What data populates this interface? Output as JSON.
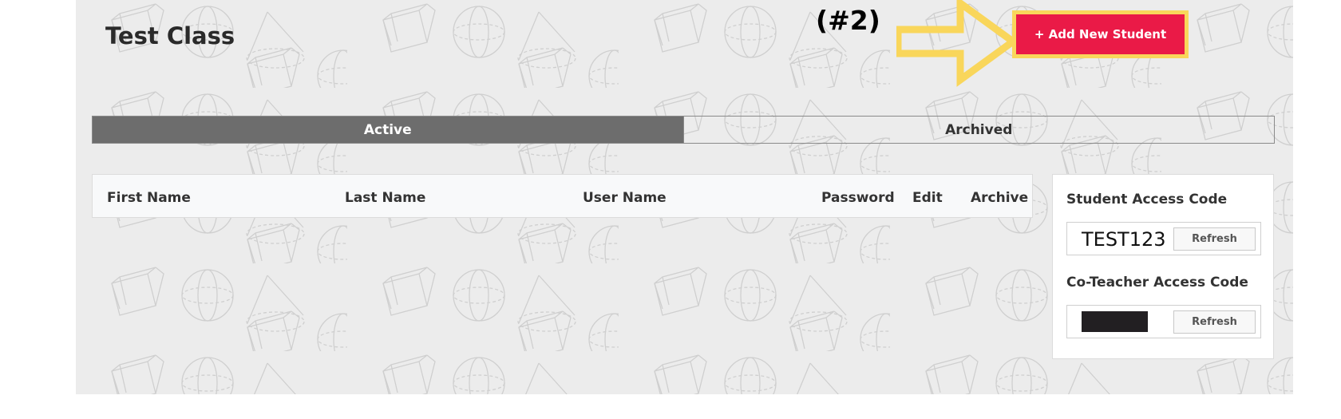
{
  "page": {
    "title": "Test Class",
    "annotation_label": "(#2)",
    "add_button_label": "+ Add New Student"
  },
  "tabs": [
    {
      "label": "Active",
      "state": "selected"
    },
    {
      "label": "Archived",
      "state": "unselected"
    }
  ],
  "table": {
    "columns": [
      "First Name",
      "Last Name",
      "User Name",
      "Password",
      "Edit",
      "Archive"
    ],
    "rows": []
  },
  "access_codes": {
    "student_label": "Student Access Code",
    "student_code": "TEST123",
    "coteacher_label": "Co-Teacher Access Code",
    "coteacher_code_state": "redacted",
    "refresh_label": "Refresh"
  },
  "colors": {
    "accent": "#ea1a47",
    "annotation": "#f9d65b",
    "tab_active": "#6d6d6d",
    "panel_bg": "#ececec"
  },
  "icons": [
    "geometric-shapes-pattern",
    "annotation-arrow"
  ]
}
